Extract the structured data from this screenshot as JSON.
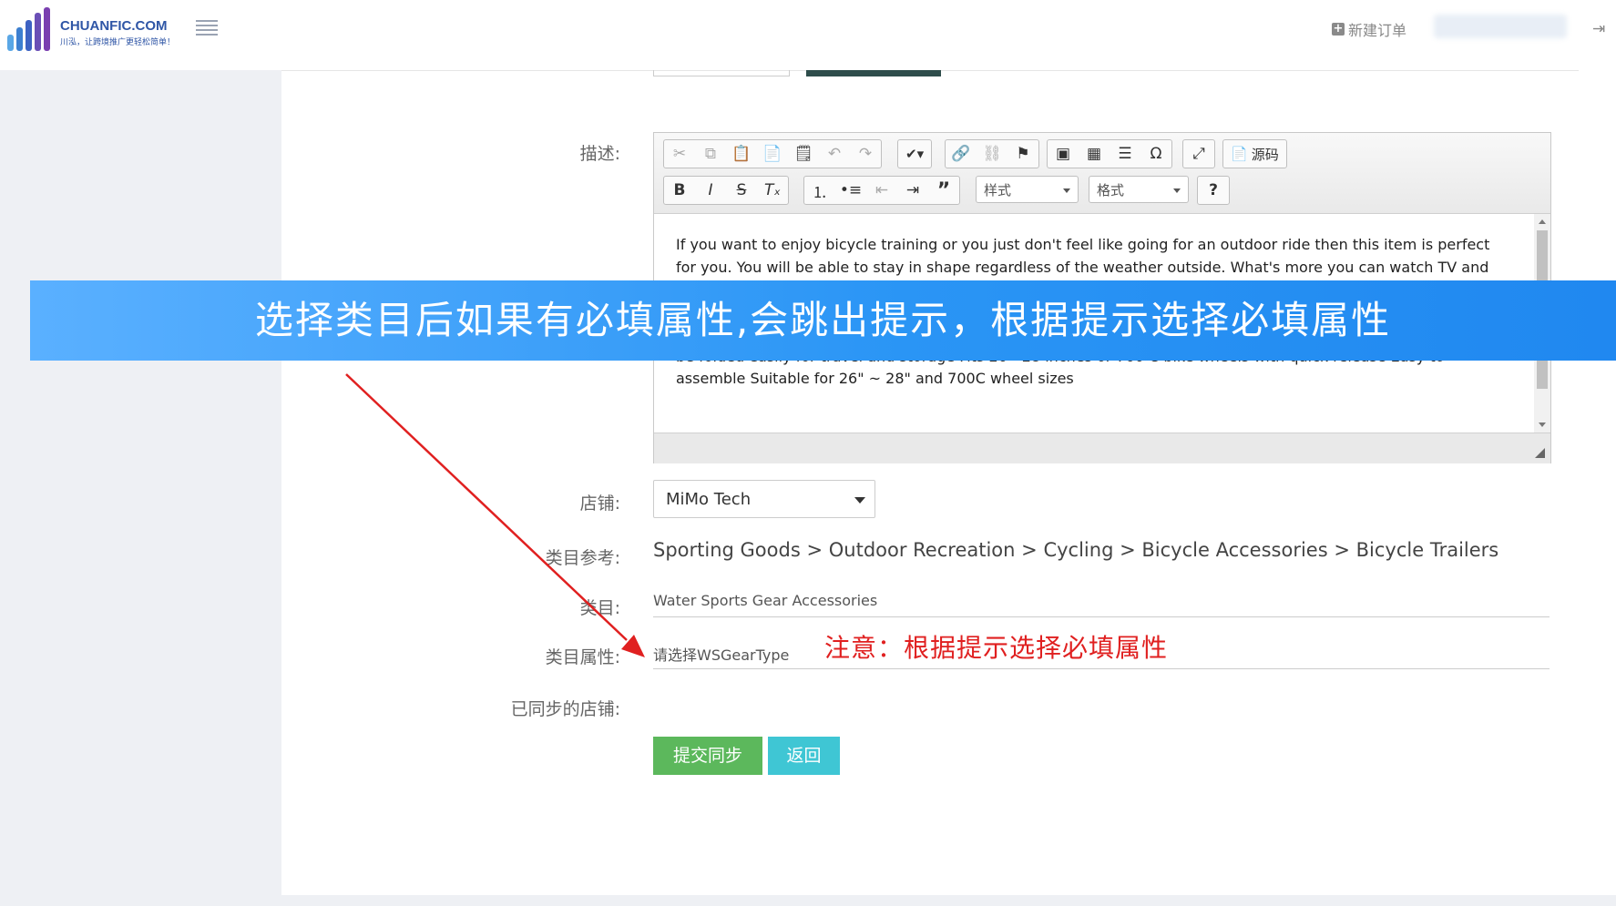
{
  "header": {
    "logo_text": "CHUANFIC.COM",
    "logo_sub": "川泓，让跨境推广更轻松简单！",
    "new_order": "新建订单",
    "colors": {
      "brand": "#2f56a6"
    }
  },
  "form": {
    "description_label": "描述:",
    "store_label": "店铺:",
    "category_ref_label": "类目参考:",
    "category_label": "类目:",
    "category_attr_label": "类目属性:",
    "synced_stores_label": "已同步的店铺:"
  },
  "editor": {
    "style_combo": "样式",
    "format_combo": "格式",
    "source_label": "源码",
    "content": "If you want to enjoy bicycle training or you just don't feel like going for an outdoor ride then this item is perfect for you.   You will be able to stay in shape regardless of the weather outside. What's more you can watch TV and ride your bike at the same time. This bike trainer stand is easy to use and it features a sturdy steel frame. It clamps down on quick release or bolts onto your bike's rear wheels Offers effective and convenient indoor training Heavy duty steel frame Smooth quiet magnetic resistance Can hook up to most bikes Portable and can be folded easily for travel and storage Fits 26 - 28 inches or 700 C bike wheels with quick release Easy to assemble Suitable for 26\" ~ 28\"  and 700C wheel sizes"
  },
  "banner": {
    "text": "选择类目后如果有必填属性,会跳出提示，根据提示选择必填属性"
  },
  "store": {
    "selected": "MiMo Tech"
  },
  "category_ref": {
    "path": [
      "Sporting Goods",
      "Outdoor Recreation",
      "Cycling",
      "Bicycle Accessories",
      "Bicycle Trailers"
    ],
    "separator": ">"
  },
  "category": {
    "value": "Water Sports Gear Accessories"
  },
  "category_attr": {
    "placeholder": "请选择WSGearType"
  },
  "annotation": {
    "note": "注意：根据提示选择必填属性"
  },
  "buttons": {
    "submit": "提交同步",
    "back": "返回"
  }
}
